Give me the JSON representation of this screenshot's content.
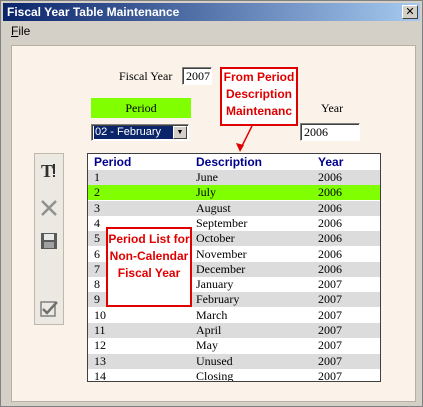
{
  "window": {
    "title": "Fiscal Year Table Maintenance",
    "close_icon": "close-icon"
  },
  "menu": {
    "file_label": "ile",
    "file_mnemonic": "F"
  },
  "form": {
    "fiscal_year_label": "Fiscal Year",
    "fiscal_year_value": "2007",
    "period_header": "Period",
    "period_selected": "02 - February",
    "year_label": "Year",
    "year_value": "2006"
  },
  "toolbar": {
    "icons": [
      "edit-icon",
      "delete-icon",
      "save-icon",
      "check-icon"
    ]
  },
  "grid": {
    "columns": [
      "Period",
      "Description",
      "Year"
    ],
    "rows": [
      [
        "1",
        "June",
        "2006"
      ],
      [
        "2",
        "July",
        "2006"
      ],
      [
        "3",
        "August",
        "2006"
      ],
      [
        "4",
        "September",
        "2006"
      ],
      [
        "5",
        "October",
        "2006"
      ],
      [
        "6",
        "November",
        "2006"
      ],
      [
        "7",
        "December",
        "2006"
      ],
      [
        "8",
        "January",
        "2007"
      ],
      [
        "9",
        "February",
        "2007"
      ],
      [
        "10",
        "March",
        "2007"
      ],
      [
        "11",
        "April",
        "2007"
      ],
      [
        "12",
        "May",
        "2007"
      ],
      [
        "13",
        "Unused",
        "2007"
      ],
      [
        "14",
        "Closing",
        "2007"
      ]
    ],
    "selected_row": 1,
    "colors": {
      "alt": "#dcdcdc",
      "selected": "#80ff00"
    }
  },
  "callouts": {
    "top": "From Period Description Maintenanc",
    "left": "Period List for Non-Calendar Fiscal Year"
  }
}
